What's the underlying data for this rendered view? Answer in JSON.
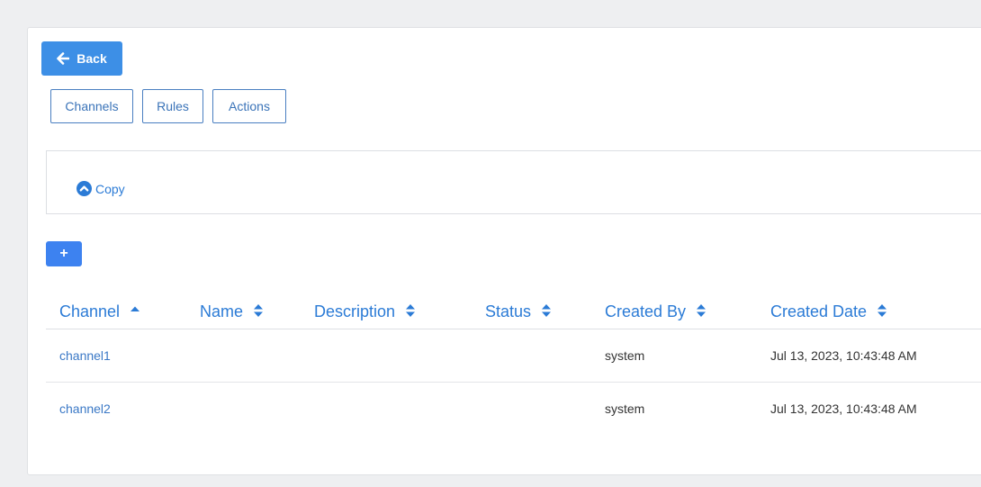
{
  "back_button": {
    "label": "Back",
    "icon": "arrow-left-icon"
  },
  "tabs": [
    {
      "label": "Channels"
    },
    {
      "label": "Rules"
    },
    {
      "label": "Actions"
    }
  ],
  "copy_panel": {
    "label": "Copy",
    "icon": "chevron-circle-up-icon"
  },
  "add_button": {
    "label": "+"
  },
  "table": {
    "columns": [
      {
        "label": "Channel",
        "sort": "ascending"
      },
      {
        "label": "Name",
        "sort": "none"
      },
      {
        "label": "Description",
        "sort": "none"
      },
      {
        "label": "Status",
        "sort": "none"
      },
      {
        "label": "Created By",
        "sort": "none"
      },
      {
        "label": "Created Date",
        "sort": "none"
      }
    ],
    "rows": [
      {
        "channel": "channel1",
        "name": "",
        "description": "",
        "status": "",
        "created_by": "system",
        "created_date": "Jul 13, 2023, 10:43:48 AM"
      },
      {
        "channel": "channel2",
        "name": "",
        "description": "",
        "status": "",
        "created_by": "system",
        "created_date": "Jul 13, 2023, 10:43:48 AM"
      }
    ]
  },
  "colors": {
    "primary": "#3d8fe6",
    "link": "#2b7bd6",
    "background": "#eeeff1"
  }
}
